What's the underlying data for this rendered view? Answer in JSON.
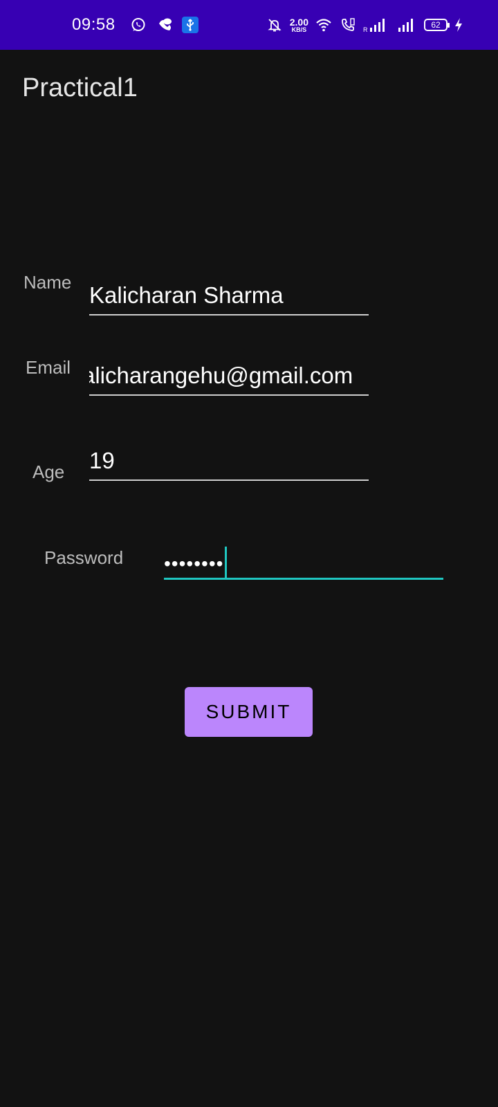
{
  "status_bar": {
    "time": "09:58",
    "speed_value": "2.00",
    "speed_unit": "KB/S",
    "sim_label": "R",
    "battery": "62",
    "icons": [
      "whatsapp-icon",
      "message-icon",
      "usb-icon",
      "mute-bell-icon",
      "wifi-icon",
      "call-icon",
      "signal-icon",
      "signal-icon",
      "battery-icon",
      "charging-icon"
    ],
    "background": "#3700B3"
  },
  "app": {
    "title": "Practical1"
  },
  "form": {
    "name_label": "Name",
    "name_value": "Kalicharan Sharma",
    "email_label": "Email",
    "email_value": "alicharangehu@gmail.com",
    "age_label": "Age",
    "age_value": "19",
    "password_label": "Password",
    "password_value": "••••••••",
    "accent_color": "#1fc7c1"
  },
  "submit": {
    "label": "SUBMIT",
    "color": "#bb86fc"
  }
}
